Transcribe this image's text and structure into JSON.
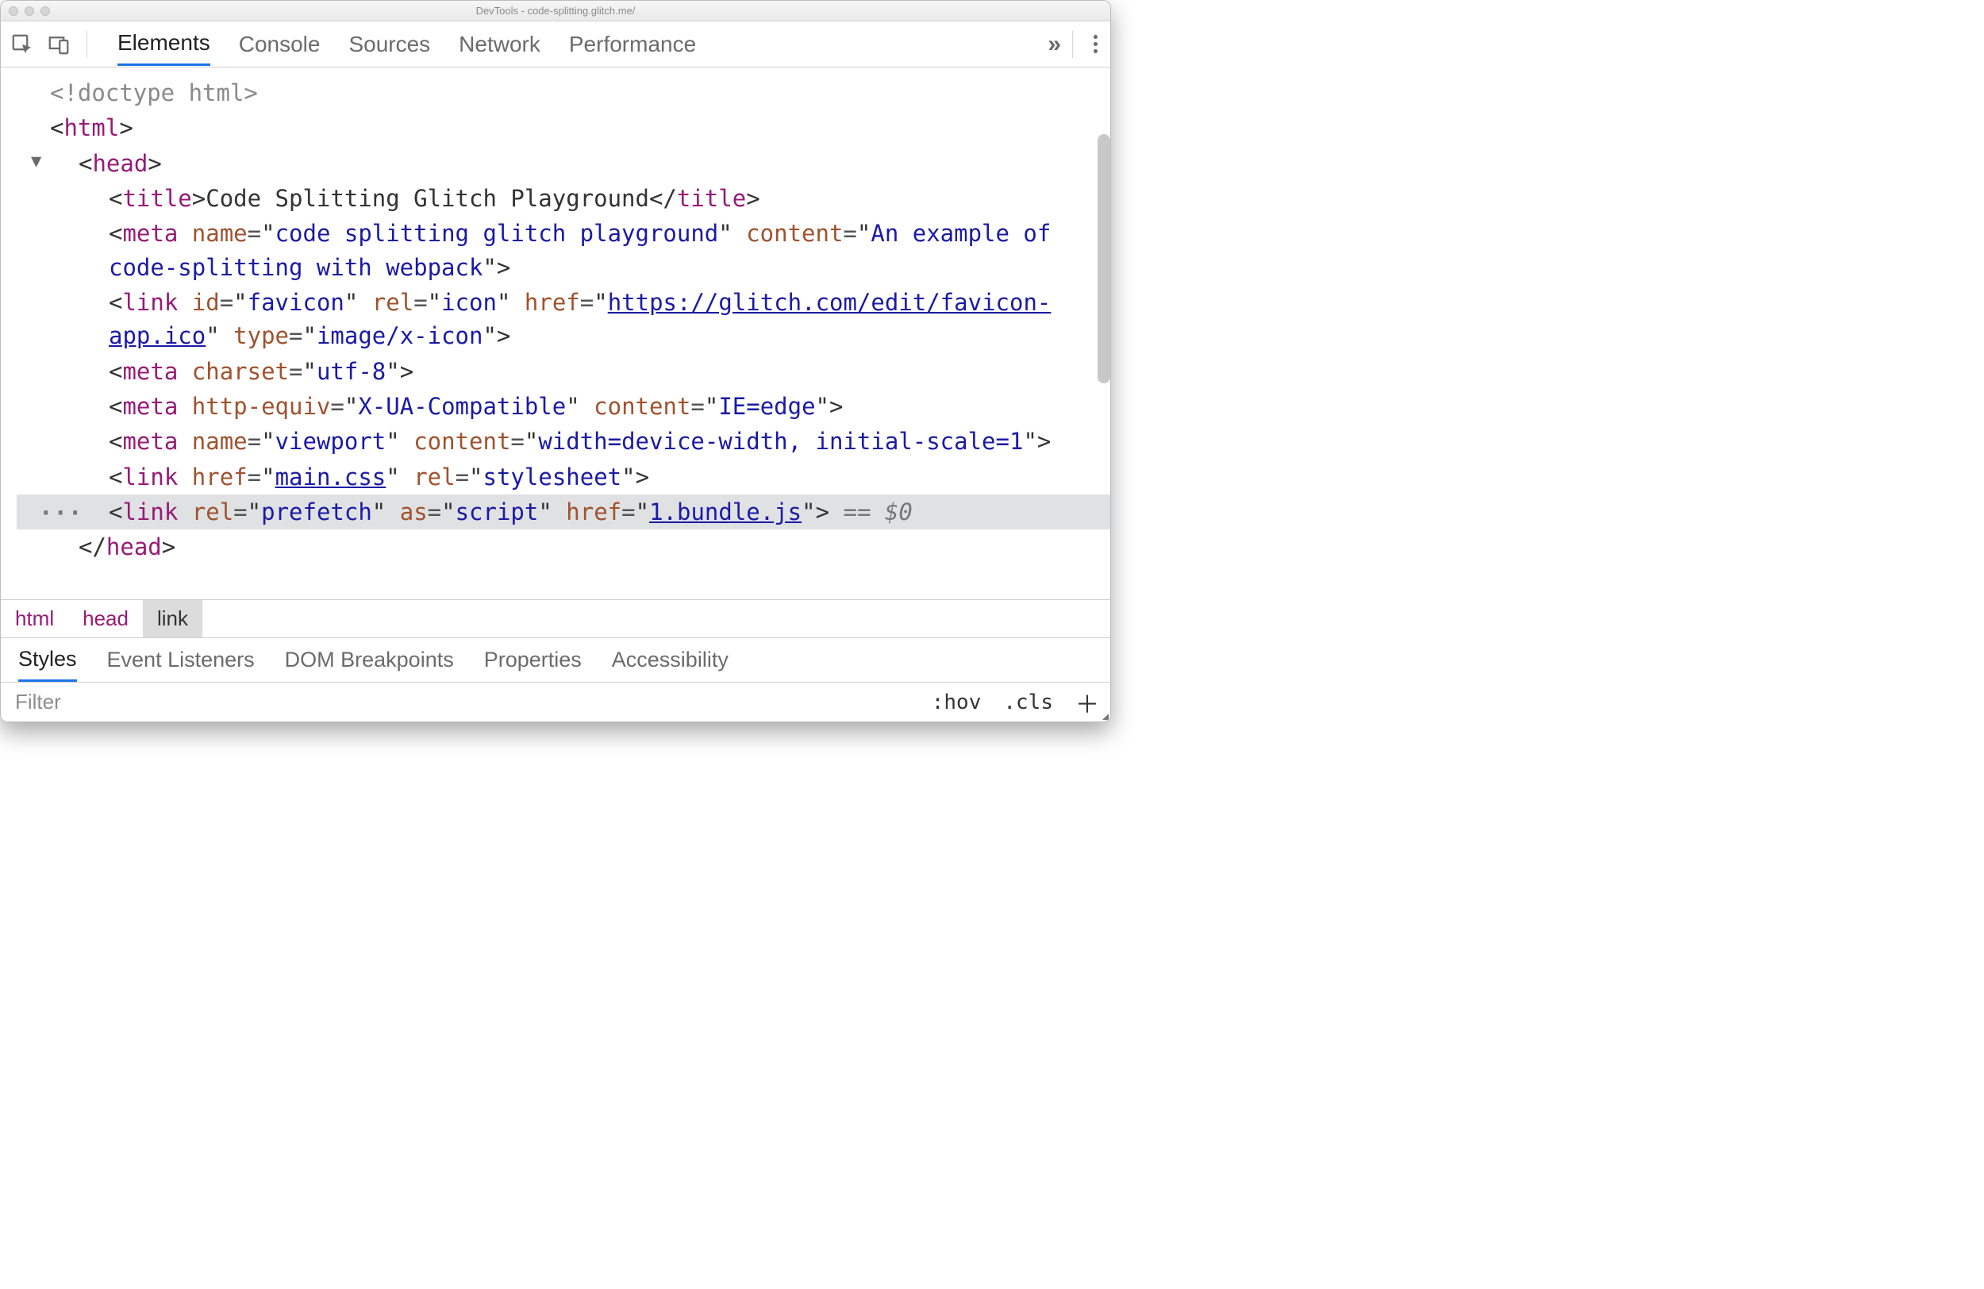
{
  "window": {
    "title": "DevTools - code-splitting.glitch.me/"
  },
  "tabs": {
    "elements": "Elements",
    "console": "Console",
    "sources": "Sources",
    "network": "Network",
    "performance": "Performance"
  },
  "tree": {
    "doctype": "<!doctype html>",
    "html_open": "html",
    "head_open": "head",
    "title_tag": "title",
    "title_text": "Code Splitting Glitch Playground",
    "meta1": {
      "tag": "meta",
      "a1": "name",
      "v1": "code splitting glitch playground",
      "a2": "content",
      "v2": "An example of code-splitting with webpack"
    },
    "link1": {
      "tag": "link",
      "a1": "id",
      "v1": "favicon",
      "a2": "rel",
      "v2": "icon",
      "a3": "href",
      "v3": "https://glitch.com/edit/favicon-app.ico",
      "a4": "type",
      "v4": "image/x-icon"
    },
    "meta2": {
      "tag": "meta",
      "a1": "charset",
      "v1": "utf-8"
    },
    "meta3": {
      "tag": "meta",
      "a1": "http-equiv",
      "v1": "X-UA-Compatible",
      "a2": "content",
      "v2": "IE=edge"
    },
    "meta4": {
      "tag": "meta",
      "a1": "name",
      "v1": "viewport",
      "a2": "content",
      "v2": "width=device-width, initial-scale=1"
    },
    "link2": {
      "tag": "link",
      "a1": "href",
      "v1": "main.css",
      "a2": "rel",
      "v2": "stylesheet"
    },
    "link3": {
      "tag": "link",
      "a1": "rel",
      "v1": "prefetch",
      "a2": "as",
      "v2": "script",
      "a3": "href",
      "v3": "1.bundle.js"
    },
    "sel_suffix": " == $0",
    "head_close": "head"
  },
  "crumbs": {
    "html": "html",
    "head": "head",
    "link": "link"
  },
  "subtabs": {
    "styles": "Styles",
    "events": "Event Listeners",
    "dombp": "DOM Breakpoints",
    "props": "Properties",
    "a11y": "Accessibility"
  },
  "filter": {
    "placeholder": "Filter",
    "hov": ":hov",
    "cls": ".cls"
  }
}
